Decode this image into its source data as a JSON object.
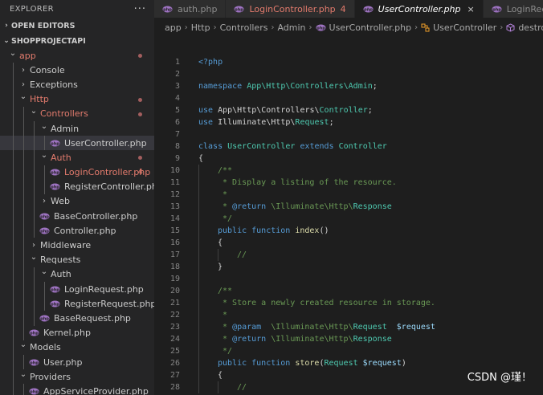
{
  "colors": {
    "php_icon": "#a074c4",
    "error": "#e37b6d",
    "sidebar_bg": "#252526",
    "editor_bg": "#1e1e1e"
  },
  "explorer": {
    "title": "EXPLORER",
    "more_icon": "ellipsis-icon",
    "sections": {
      "open_editors": "OPEN EDITORS",
      "project": "SHOPPROJECTAPI"
    },
    "tree": [
      {
        "label": "app",
        "type": "folder",
        "depth": 0,
        "expanded": true,
        "status": "error",
        "dot": true
      },
      {
        "label": "Console",
        "type": "folder",
        "depth": 1,
        "expanded": false
      },
      {
        "label": "Exceptions",
        "type": "folder",
        "depth": 1,
        "expanded": false
      },
      {
        "label": "Http",
        "type": "folder",
        "depth": 1,
        "expanded": true,
        "status": "error",
        "dot": true
      },
      {
        "label": "Controllers",
        "type": "folder",
        "depth": 2,
        "expanded": true,
        "status": "error",
        "dot": true
      },
      {
        "label": "Admin",
        "type": "folder",
        "depth": 3,
        "expanded": true
      },
      {
        "label": "UserController.php",
        "type": "file",
        "depth": 4,
        "selected": true
      },
      {
        "label": "Auth",
        "type": "folder",
        "depth": 3,
        "expanded": true,
        "status": "error",
        "dot": true
      },
      {
        "label": "LoginController.php",
        "type": "file",
        "depth": 4,
        "status": "error",
        "badge": "4"
      },
      {
        "label": "RegisterController.php",
        "type": "file",
        "depth": 4
      },
      {
        "label": "Web",
        "type": "folder",
        "depth": 3,
        "expanded": false
      },
      {
        "label": "BaseController.php",
        "type": "file",
        "depth": 3
      },
      {
        "label": "Controller.php",
        "type": "file",
        "depth": 3
      },
      {
        "label": "Middleware",
        "type": "folder",
        "depth": 2,
        "expanded": false
      },
      {
        "label": "Requests",
        "type": "folder",
        "depth": 2,
        "expanded": true
      },
      {
        "label": "Auth",
        "type": "folder",
        "depth": 3,
        "expanded": true
      },
      {
        "label": "LoginRequest.php",
        "type": "file",
        "depth": 4
      },
      {
        "label": "RegisterRequest.php",
        "type": "file",
        "depth": 4
      },
      {
        "label": "BaseRequest.php",
        "type": "file",
        "depth": 3
      },
      {
        "label": "Kernel.php",
        "type": "file",
        "depth": 2
      },
      {
        "label": "Models",
        "type": "folder",
        "depth": 1,
        "expanded": true
      },
      {
        "label": "User.php",
        "type": "file",
        "depth": 2
      },
      {
        "label": "Providers",
        "type": "folder",
        "depth": 1,
        "expanded": true
      },
      {
        "label": "AppServiceProvider.php",
        "type": "file",
        "depth": 2
      }
    ]
  },
  "tabs": [
    {
      "label": "auth.php",
      "active": false
    },
    {
      "label": "LoginController.php",
      "active": false,
      "status": "error",
      "badge": "4"
    },
    {
      "label": "UserController.php",
      "active": true,
      "close": "×"
    },
    {
      "label": "LoginRequest.php",
      "active": false
    }
  ],
  "breadcrumb": {
    "items": [
      "app",
      "Http",
      "Controllers",
      "Admin"
    ],
    "file": "UserController.php",
    "class_name": "UserController",
    "method_name": "destroy",
    "class_icon": "class-symbol-icon",
    "method_icon": "method-cube-icon"
  },
  "editor": {
    "lines": [
      {
        "n": "1",
        "indent": 0,
        "tokens": [
          [
            "kw",
            "<?php"
          ]
        ]
      },
      {
        "n": "2",
        "indent": 0,
        "tokens": []
      },
      {
        "n": "3",
        "indent": 0,
        "tokens": [
          [
            "kw",
            "namespace "
          ],
          [
            "cls",
            "App\\Http\\Controllers\\Admin"
          ],
          [
            "txt",
            ";"
          ]
        ]
      },
      {
        "n": "4",
        "indent": 0,
        "tokens": []
      },
      {
        "n": "5",
        "indent": 0,
        "tokens": [
          [
            "kw",
            "use "
          ],
          [
            "txt",
            "App\\Http\\Controllers\\"
          ],
          [
            "cls",
            "Controller"
          ],
          [
            "txt",
            ";"
          ]
        ]
      },
      {
        "n": "6",
        "indent": 0,
        "tokens": [
          [
            "kw",
            "use "
          ],
          [
            "txt",
            "Illuminate\\Http\\"
          ],
          [
            "cls",
            "Request"
          ],
          [
            "txt",
            ";"
          ]
        ]
      },
      {
        "n": "7",
        "indent": 0,
        "tokens": []
      },
      {
        "n": "8",
        "indent": 0,
        "tokens": [
          [
            "kw",
            "class "
          ],
          [
            "cls",
            "UserController "
          ],
          [
            "kw",
            "extends "
          ],
          [
            "cls",
            "Controller"
          ]
        ]
      },
      {
        "n": "9",
        "indent": 0,
        "tokens": [
          [
            "txt",
            "{"
          ]
        ]
      },
      {
        "n": "10",
        "indent": 1,
        "tokens": [
          [
            "com",
            "/**"
          ]
        ]
      },
      {
        "n": "11",
        "indent": 1,
        "tokens": [
          [
            "com",
            " * Display a listing of the resource."
          ]
        ]
      },
      {
        "n": "12",
        "indent": 1,
        "tokens": [
          [
            "com",
            " *"
          ]
        ]
      },
      {
        "n": "13",
        "indent": 1,
        "tokens": [
          [
            "com",
            " * "
          ],
          [
            "kw",
            "@return "
          ],
          [
            "com",
            "\\Illuminate\\Http\\"
          ],
          [
            "cls",
            "Response"
          ]
        ]
      },
      {
        "n": "14",
        "indent": 1,
        "tokens": [
          [
            "com",
            " */"
          ]
        ]
      },
      {
        "n": "15",
        "indent": 1,
        "tokens": [
          [
            "kw",
            "public function "
          ],
          [
            "fn",
            "index"
          ],
          [
            "txt",
            "()"
          ]
        ]
      },
      {
        "n": "16",
        "indent": 1,
        "tokens": [
          [
            "txt",
            "{"
          ]
        ]
      },
      {
        "n": "17",
        "indent": 2,
        "tokens": [
          [
            "com",
            "//"
          ]
        ]
      },
      {
        "n": "18",
        "indent": 1,
        "tokens": [
          [
            "txt",
            "}"
          ]
        ]
      },
      {
        "n": "19",
        "indent": 1,
        "tokens": []
      },
      {
        "n": "20",
        "indent": 1,
        "tokens": [
          [
            "com",
            "/**"
          ]
        ]
      },
      {
        "n": "21",
        "indent": 1,
        "tokens": [
          [
            "com",
            " * Store a newly created resource in storage."
          ]
        ]
      },
      {
        "n": "22",
        "indent": 1,
        "tokens": [
          [
            "com",
            " *"
          ]
        ]
      },
      {
        "n": "23",
        "indent": 1,
        "tokens": [
          [
            "com",
            " * "
          ],
          [
            "kw",
            "@param  "
          ],
          [
            "com",
            "\\Illuminate\\Http\\"
          ],
          [
            "cls",
            "Request  "
          ],
          [
            "var",
            "$request"
          ]
        ]
      },
      {
        "n": "24",
        "indent": 1,
        "tokens": [
          [
            "com",
            " * "
          ],
          [
            "kw",
            "@return "
          ],
          [
            "com",
            "\\Illuminate\\Http\\"
          ],
          [
            "cls",
            "Response"
          ]
        ]
      },
      {
        "n": "25",
        "indent": 1,
        "tokens": [
          [
            "com",
            " */"
          ]
        ]
      },
      {
        "n": "26",
        "indent": 1,
        "tokens": [
          [
            "kw",
            "public function "
          ],
          [
            "fn",
            "store"
          ],
          [
            "txt",
            "("
          ],
          [
            "cls",
            "Request "
          ],
          [
            "var",
            "$request"
          ],
          [
            "txt",
            ")"
          ]
        ]
      },
      {
        "n": "27",
        "indent": 1,
        "tokens": [
          [
            "txt",
            "{"
          ]
        ]
      },
      {
        "n": "28",
        "indent": 2,
        "tokens": [
          [
            "com",
            "//"
          ]
        ]
      }
    ]
  },
  "watermark": "CSDN @瑾！"
}
